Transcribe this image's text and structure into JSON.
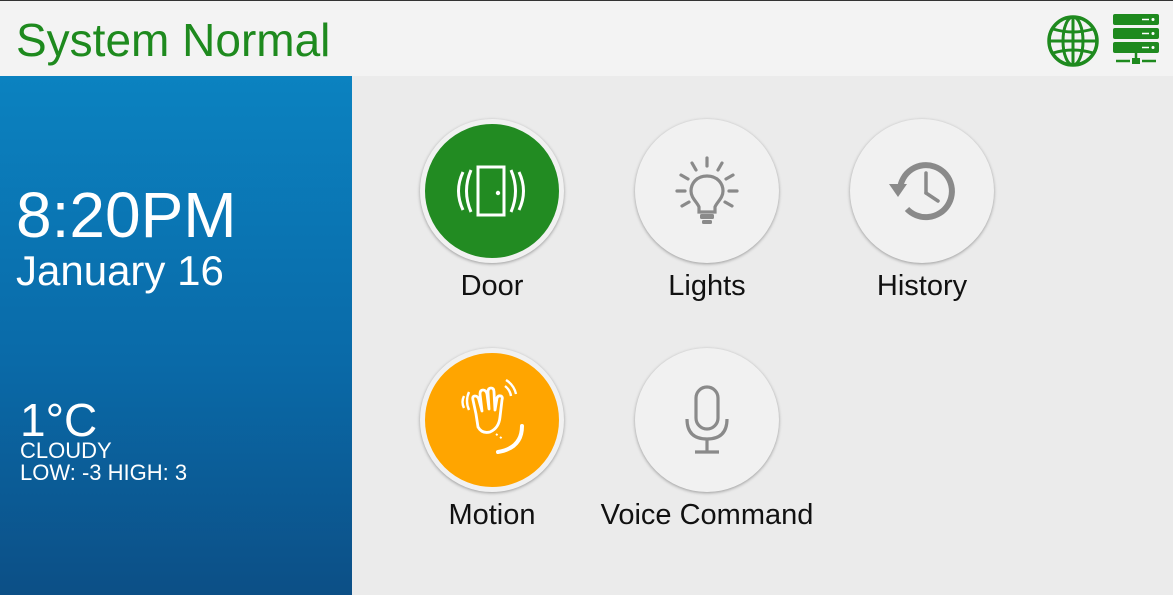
{
  "header": {
    "status": "System Normal",
    "status_color": "#1e8a1e",
    "icons": [
      "globe-icon",
      "server-icon"
    ]
  },
  "clock": {
    "time": "8:20PM",
    "date": "January 16"
  },
  "weather": {
    "temperature": "1°C",
    "condition": "CLOUDY",
    "low_high": "LOW: -3 HIGH: 3"
  },
  "tiles": [
    {
      "label": "Door",
      "icon": "door-vibrate-icon",
      "color": "#228b22"
    },
    {
      "label": "Lights",
      "icon": "lightbulb-icon",
      "color": "#f1f1f1"
    },
    {
      "label": "History",
      "icon": "history-clock-icon",
      "color": "#f1f1f1"
    },
    {
      "label": "Motion",
      "icon": "waving-hand-icon",
      "color": "#ffa500"
    },
    {
      "label": "Voice Command",
      "icon": "microphone-icon",
      "color": "#f1f1f1"
    }
  ]
}
